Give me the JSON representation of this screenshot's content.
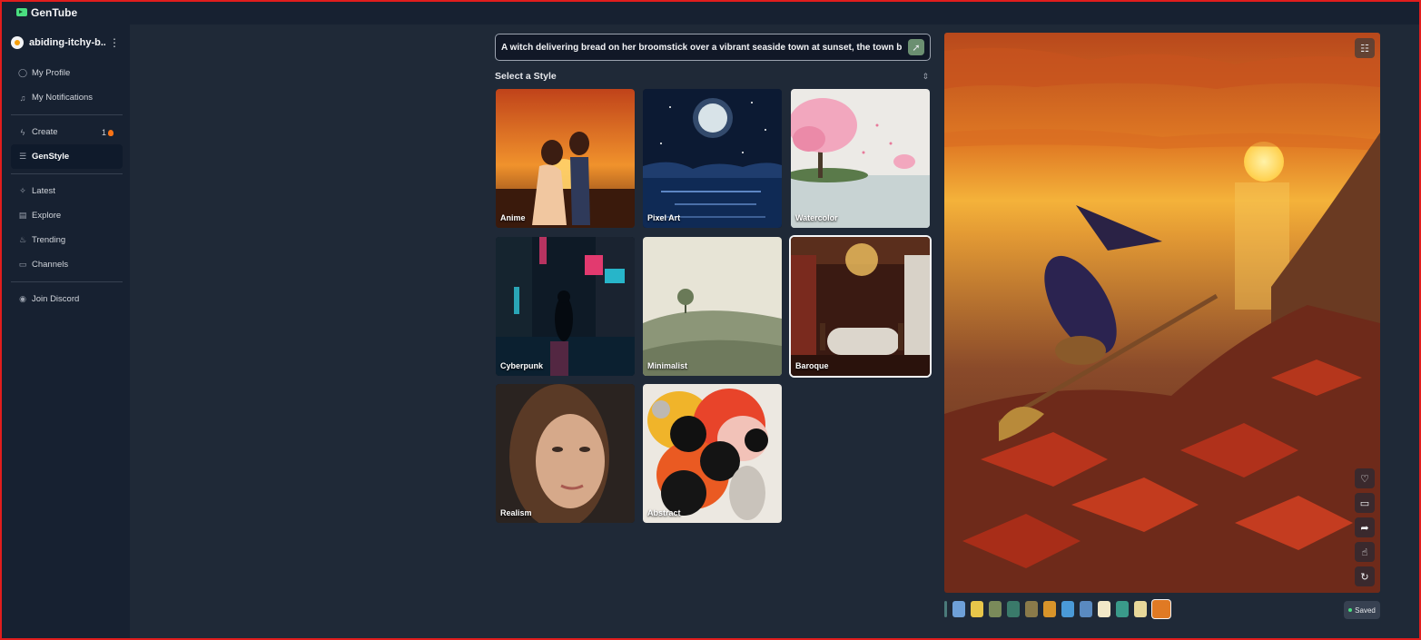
{
  "app": {
    "title": "GenTube"
  },
  "sidebar": {
    "username": "abiding-itchy-b...",
    "items": [
      {
        "label": "My Profile",
        "icon": "user-icon"
      },
      {
        "label": "My Notifications",
        "icon": "bell-icon"
      },
      {
        "label": "Create",
        "icon": "spark-icon",
        "badge": "1"
      },
      {
        "label": "GenStyle",
        "icon": "sliders-icon"
      },
      {
        "label": "Latest",
        "icon": "sparkles-icon"
      },
      {
        "label": "Explore",
        "icon": "book-icon"
      },
      {
        "label": "Trending",
        "icon": "flame-icon"
      },
      {
        "label": "Channels",
        "icon": "tv-icon"
      },
      {
        "label": "Join Discord",
        "icon": "discord-icon"
      }
    ]
  },
  "prompt": {
    "value": "A witch delivering bread on her broomstick over a vibrant seaside town at sunset, the town b"
  },
  "styles": {
    "header": "Select a Style",
    "cards": [
      {
        "label": "Anime"
      },
      {
        "label": "Pixel Art"
      },
      {
        "label": "Watercolor"
      },
      {
        "label": "Cyberpunk"
      },
      {
        "label": "Minimalist"
      },
      {
        "label": "Baroque",
        "selected": true
      },
      {
        "label": "Realism"
      },
      {
        "label": "Abstract"
      }
    ]
  },
  "preview": {
    "status": "Saved",
    "accent_colors": {
      "saved_dot": "#4ade80",
      "go_button": "#6b8f71"
    }
  }
}
